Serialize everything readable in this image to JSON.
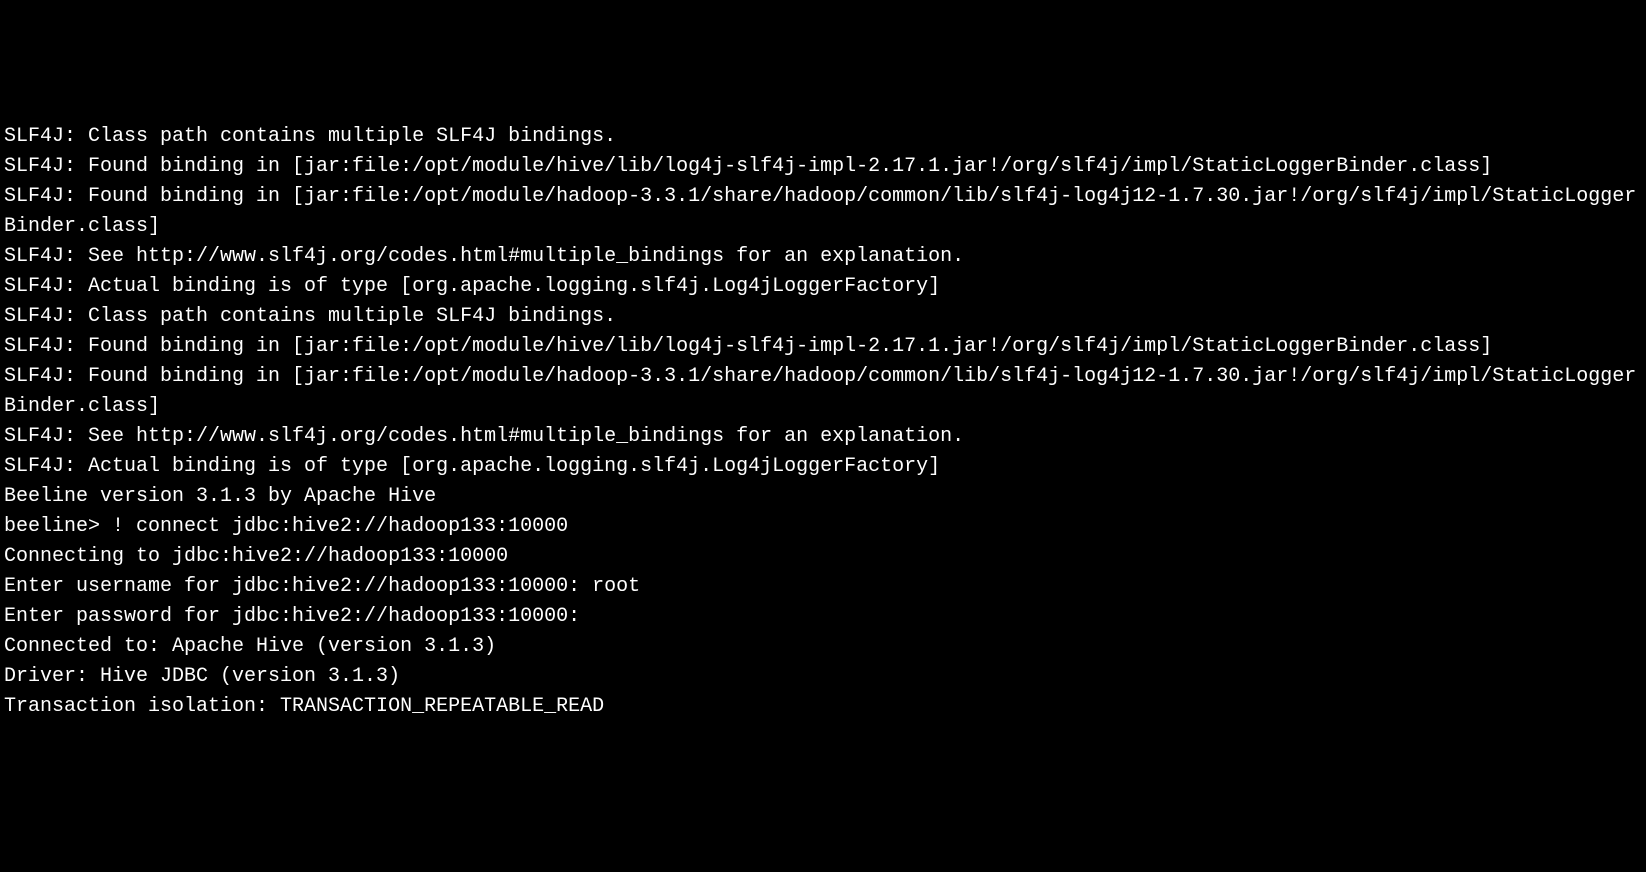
{
  "terminal": {
    "lines": [
      "SLF4J: Class path contains multiple SLF4J bindings.",
      "SLF4J: Found binding in [jar:file:/opt/module/hive/lib/log4j-slf4j-impl-2.17.1.jar!/org/slf4j/impl/StaticLoggerBinder.class]",
      "SLF4J: Found binding in [jar:file:/opt/module/hadoop-3.3.1/share/hadoop/common/lib/slf4j-log4j12-1.7.30.jar!/org/slf4j/impl/StaticLoggerBinder.class]",
      "SLF4J: See http://www.slf4j.org/codes.html#multiple_bindings for an explanation.",
      "SLF4J: Actual binding is of type [org.apache.logging.slf4j.Log4jLoggerFactory]",
      "SLF4J: Class path contains multiple SLF4J bindings.",
      "SLF4J: Found binding in [jar:file:/opt/module/hive/lib/log4j-slf4j-impl-2.17.1.jar!/org/slf4j/impl/StaticLoggerBinder.class]",
      "SLF4J: Found binding in [jar:file:/opt/module/hadoop-3.3.1/share/hadoop/common/lib/slf4j-log4j12-1.7.30.jar!/org/slf4j/impl/StaticLoggerBinder.class]",
      "SLF4J: See http://www.slf4j.org/codes.html#multiple_bindings for an explanation.",
      "SLF4J: Actual binding is of type [org.apache.logging.slf4j.Log4jLoggerFactory]",
      "Beeline version 3.1.3 by Apache Hive",
      "beeline> ! connect jdbc:hive2://hadoop133:10000",
      "Connecting to jdbc:hive2://hadoop133:10000",
      "Enter username for jdbc:hive2://hadoop133:10000: root",
      "Enter password for jdbc:hive2://hadoop133:10000:",
      "Connected to: Apache Hive (version 3.1.3)",
      "Driver: Hive JDBC (version 3.1.3)",
      "Transaction isolation: TRANSACTION_REPEATABLE_READ"
    ]
  }
}
